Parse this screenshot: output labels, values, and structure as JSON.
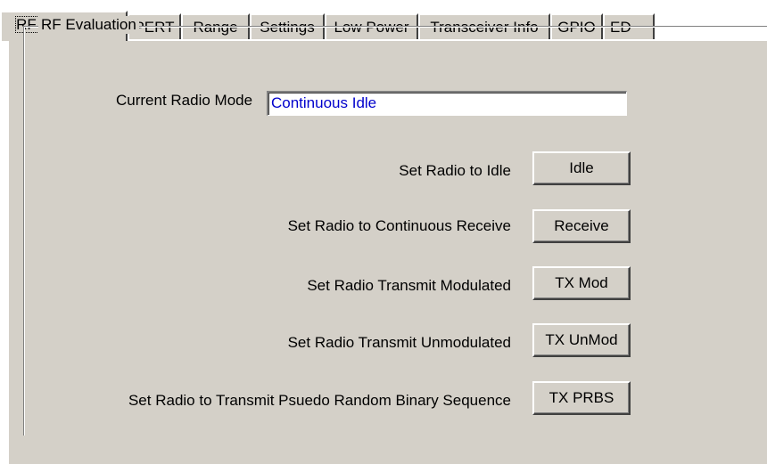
{
  "tabs": [
    {
      "label": "RF Evaluation",
      "active": true
    },
    {
      "label": "PERT",
      "active": false
    },
    {
      "label": "Range",
      "active": false
    },
    {
      "label": "Settings",
      "active": false
    },
    {
      "label": "Low Power",
      "active": false
    },
    {
      "label": "Transceiver Info",
      "active": false
    },
    {
      "label": "GPIO",
      "active": false
    },
    {
      "label": "ED",
      "active": false
    }
  ],
  "group": {
    "title": "RF Evaluation"
  },
  "current_mode": {
    "label": "Current Radio Mode",
    "value": "Continuous Idle"
  },
  "actions": [
    {
      "description": "Set Radio to Idle",
      "button": "Idle"
    },
    {
      "description": "Set Radio to  Continuous Receive",
      "button": "Receive"
    },
    {
      "description": "Set Radio Transmit Modulated",
      "button": "TX Mod"
    },
    {
      "description": "Set Radio Transmit Unmodulated",
      "button": "TX UnMod"
    },
    {
      "description": "Set Radio to Transmit Psuedo Random Binary Sequence",
      "button": "TX PRBS"
    }
  ],
  "colors": {
    "panel_bg": "#d4d0c8",
    "mode_text": "#0000cc"
  }
}
